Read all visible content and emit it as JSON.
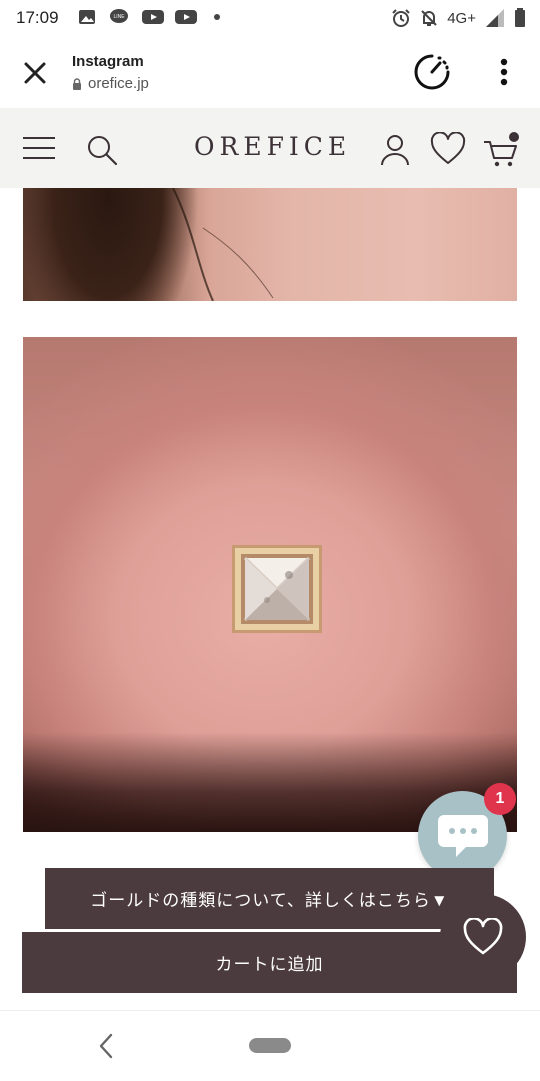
{
  "status_bar": {
    "time": "17:09",
    "left_icons": [
      "gallery-icon",
      "line-icon",
      "youtube-icon",
      "youtube-icon",
      "dot-icon"
    ],
    "network": "4G+",
    "right_icons": [
      "alarm-icon",
      "bell-off-icon",
      "signal-icon",
      "battery-icon"
    ]
  },
  "browser": {
    "title": "Instagram",
    "url": "orefice.jp"
  },
  "header": {
    "brand": "OREFICE"
  },
  "chat": {
    "badge_count": "1"
  },
  "buttons": {
    "gold_info_label": "ゴールドの種類について、詳しくはこちら▼",
    "add_to_cart_label": "カートに追加"
  },
  "colors": {
    "primary_button": "#4b3a3e",
    "header_bg": "#f3f3f2",
    "chat_bg": "#a8c1c6",
    "badge": "#e0334c"
  }
}
